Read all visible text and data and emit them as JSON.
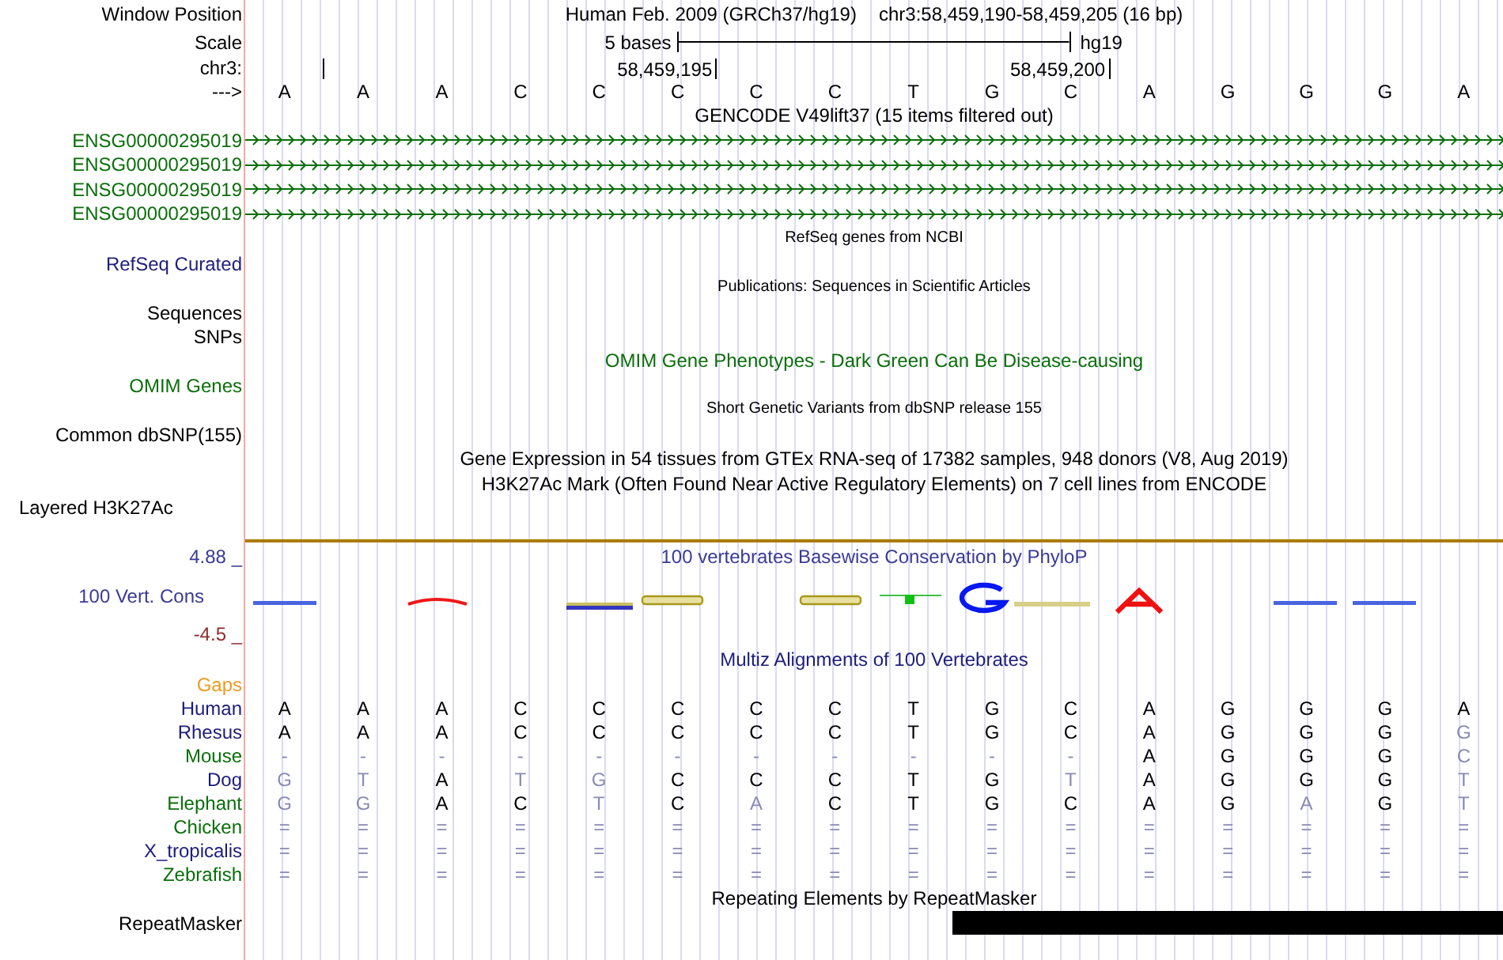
{
  "header": {
    "label": "Window Position",
    "title": "Human Feb. 2009 (GRCh37/hg19)",
    "position": "chr3:58,459,190-58,459,205 (16 bp)"
  },
  "scale": {
    "label": "Scale",
    "length": "5 bases",
    "assembly": "hg19"
  },
  "ruler": {
    "label": "chr3:",
    "ticks": [
      "58,459,195",
      "58,459,200"
    ]
  },
  "sequence": {
    "label": "--->",
    "bases": [
      "A",
      "A",
      "A",
      "C",
      "C",
      "C",
      "C",
      "C",
      "T",
      "G",
      "C",
      "A",
      "G",
      "G",
      "G",
      "A"
    ]
  },
  "tracks": [
    {
      "kind": "title",
      "title": "GENCODE V49lift37 (15 items filtered out)",
      "color": "#000000"
    },
    {
      "kind": "gene",
      "label": "ENSG00000295019",
      "color": "#0a6e0a"
    },
    {
      "kind": "gene",
      "label": "ENSG00000295019",
      "color": "#0a6e0a"
    },
    {
      "kind": "gene",
      "label": "ENSG00000295019",
      "color": "#0a6e0a"
    },
    {
      "kind": "gene",
      "label": "ENSG00000295019",
      "color": "#0a6e0a"
    },
    {
      "kind": "small-title",
      "title": "RefSeq genes from NCBI",
      "color": "#000000"
    },
    {
      "kind": "label",
      "label": "RefSeq Curated",
      "color": "#20207c"
    },
    {
      "kind": "small-title",
      "title": "Publications: Sequences in Scientific Articles",
      "color": "#000000"
    },
    {
      "kind": "label",
      "label": "Sequences",
      "color": "#000000"
    },
    {
      "kind": "label",
      "label": "SNPs",
      "color": "#000000"
    },
    {
      "kind": "title",
      "title": "OMIM Gene Phenotypes - Dark Green Can Be Disease-causing",
      "color": "#0a6e0a"
    },
    {
      "kind": "label",
      "label": "OMIM Genes",
      "color": "#0a6e0a"
    },
    {
      "kind": "small-title",
      "title": "Short Genetic Variants from dbSNP release 155",
      "color": "#000000"
    },
    {
      "kind": "label",
      "label": "Common dbSNP(155)",
      "color": "#000000"
    },
    {
      "kind": "title",
      "title": "Gene Expression in 54 tissues from GTEx RNA-seq of 17382 samples, 948 donors (V8, Aug 2019)",
      "color": "#000000"
    },
    {
      "kind": "title",
      "title": "H3K27Ac Mark (Often Found Near Active Regulatory Elements) on 7 cell lines from ENCODE",
      "color": "#000000"
    },
    {
      "kind": "layered",
      "label": "Layered H3K27Ac",
      "color": "#000000"
    },
    {
      "kind": "scale-top",
      "label": "4.88 _",
      "title": "100 vertebrates Basewise Conservation by PhyloP",
      "color": "#3a3a96"
    },
    {
      "kind": "logo",
      "label": "100 Vert. Cons",
      "color": "#3a3a96"
    },
    {
      "kind": "scale-bottom",
      "label": "-4.5 _",
      "color": "#8b2e2e"
    },
    {
      "kind": "title",
      "title": "Multiz Alignments of 100 Vertebrates",
      "color": "#1c1c7c"
    },
    {
      "kind": "gaps",
      "label": "Gaps",
      "color": "#f09a20"
    },
    {
      "kind": "species",
      "label": "Human",
      "color": "#1c1c7c",
      "bases": [
        "A",
        "A",
        "A",
        "C",
        "C",
        "C",
        "C",
        "C",
        "T",
        "G",
        "C",
        "A",
        "G",
        "G",
        "G",
        "A"
      ]
    },
    {
      "kind": "species",
      "label": "Rhesus",
      "color": "#1c1c7c",
      "bases": [
        "A",
        "A",
        "A",
        "C",
        "C",
        "C",
        "C",
        "C",
        "T",
        "G",
        "C",
        "A",
        "G",
        "G",
        "G",
        "G"
      ]
    },
    {
      "kind": "species",
      "label": "Mouse",
      "color": "#0a6e0a",
      "bases": [
        "-",
        "-",
        "-",
        "-",
        "-",
        "-",
        "-",
        "-",
        "-",
        "-",
        "-",
        "A",
        "G",
        "G",
        "G",
        "C"
      ]
    },
    {
      "kind": "species",
      "label": "Dog",
      "color": "#1c1c7c",
      "bases": [
        "G",
        "T",
        "A",
        "T",
        "G",
        "C",
        "C",
        "C",
        "T",
        "G",
        "T",
        "A",
        "G",
        "G",
        "G",
        "T"
      ]
    },
    {
      "kind": "species",
      "label": "Elephant",
      "color": "#0a6e0a",
      "bases": [
        "G",
        "G",
        "A",
        "C",
        "T",
        "C",
        "A",
        "C",
        "T",
        "G",
        "C",
        "A",
        "G",
        "A",
        "G",
        "T"
      ]
    },
    {
      "kind": "species",
      "label": "Chicken",
      "color": "#0a6e0a",
      "bases": [
        "=",
        "=",
        "=",
        "=",
        "=",
        "=",
        "=",
        "=",
        "=",
        "=",
        "=",
        "=",
        "=",
        "=",
        "=",
        "="
      ]
    },
    {
      "kind": "species",
      "label": "X_tropicalis",
      "color": "#1c1c7c",
      "bases": [
        "=",
        "=",
        "=",
        "=",
        "=",
        "=",
        "=",
        "=",
        "=",
        "=",
        "=",
        "=",
        "=",
        "=",
        "=",
        "="
      ]
    },
    {
      "kind": "species",
      "label": "Zebrafish",
      "color": "#0a6e0a",
      "bases": [
        "=",
        "=",
        "=",
        "=",
        "=",
        "=",
        "=",
        "=",
        "=",
        "=",
        "=",
        "=",
        "=",
        "=",
        "=",
        "="
      ]
    },
    {
      "kind": "title",
      "title": "Repeating Elements by RepeatMasker",
      "color": "#000000"
    },
    {
      "kind": "repeat",
      "label": "RepeatMasker",
      "color": "#000000"
    }
  ]
}
